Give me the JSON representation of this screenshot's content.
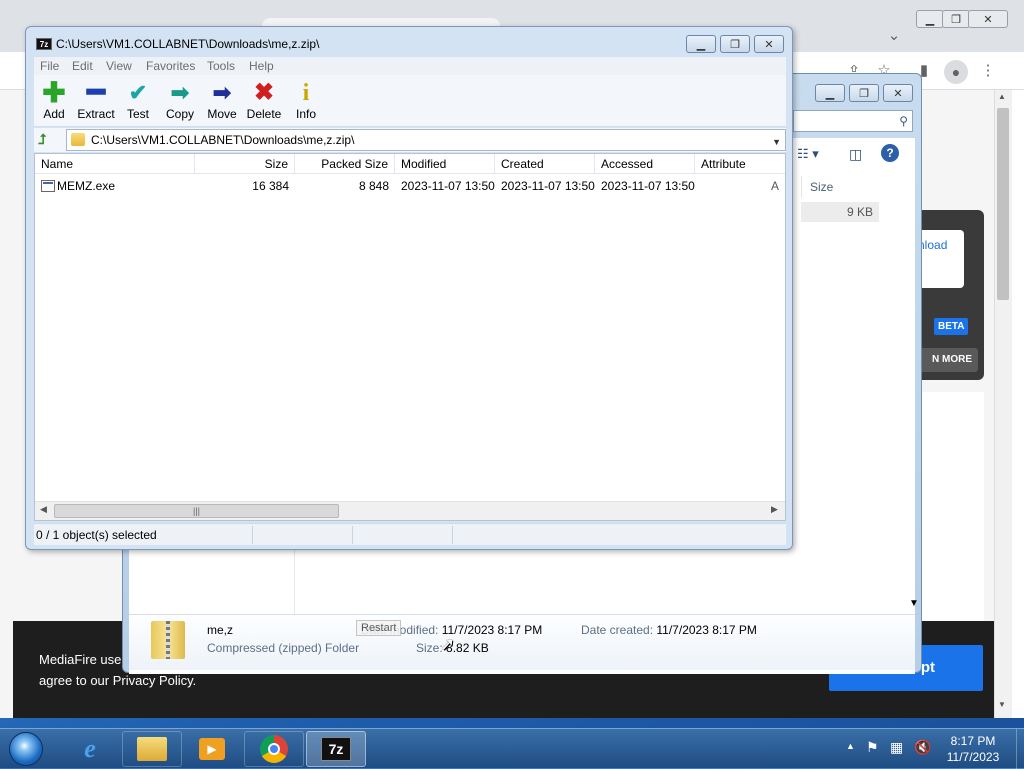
{
  "sevenzip": {
    "title": "C:\\Users\\VM1.COLLABNET\\Downloads\\me,z.zip\\",
    "app_icon": "7z",
    "menu": [
      "File",
      "Edit",
      "View",
      "Favorites",
      "Tools",
      "Help"
    ],
    "toolbar": [
      {
        "label": "Add",
        "icon": "plus-icon",
        "color": "#2aa52a"
      },
      {
        "label": "Extract",
        "icon": "minus-icon",
        "color": "#1f3fb0"
      },
      {
        "label": "Test",
        "icon": "check-icon",
        "color": "#1aa6a6"
      },
      {
        "label": "Copy",
        "icon": "arrow-right-icon",
        "color": "#1a9a8a"
      },
      {
        "label": "Move",
        "icon": "arrow-right-icon",
        "color": "#1f2f9a"
      },
      {
        "label": "Delete",
        "icon": "x-icon",
        "color": "#d01f1f"
      },
      {
        "label": "Info",
        "icon": "info-icon",
        "color": "#c9a800"
      }
    ],
    "path": "C:\\Users\\VM1.COLLABNET\\Downloads\\me,z.zip\\",
    "columns": [
      "Name",
      "Size",
      "Packed Size",
      "Modified",
      "Created",
      "Accessed",
      "Attribute"
    ],
    "files": [
      {
        "name": "MEMZ.exe",
        "size": "16 384",
        "packed": "8 848",
        "modified": "2023-11-07 13:50",
        "created": "2023-11-07 13:50",
        "accessed": "2023-11-07 13:50",
        "attr": "A"
      }
    ],
    "status": "0 / 1 object(s) selected"
  },
  "explorer": {
    "size_header": "Size",
    "size_value": "9 KB",
    "detail": {
      "name": "me,z",
      "type": "Compressed (zipped) Folder",
      "date_modified_label": "Date modified:",
      "date_modified": "11/7/2023 8:17 PM",
      "date_created_label": "Date created:",
      "date_created": "11/7/2023 8:17 PM",
      "size_label": "Size:",
      "size": "8.82 KB"
    },
    "tooltip": "Restart"
  },
  "mediafire": {
    "download": "nload",
    "beta": "BETA",
    "learn_more": "N MORE",
    "cookie_line1": "MediaFire use",
    "cookie_line2": "agree to our Privacy Policy.",
    "accept": "pt"
  },
  "taskbar": {
    "apps": [
      "ie-icon",
      "explorer-icon",
      "media-player-icon",
      "chrome-icon",
      "7zip-icon"
    ],
    "time": "8:17 PM",
    "date": "11/7/2023"
  }
}
